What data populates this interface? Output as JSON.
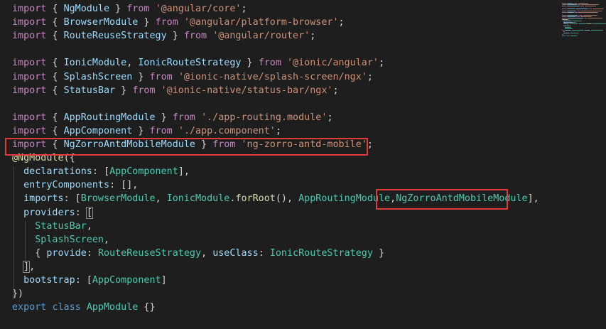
{
  "editor": {
    "language": "typescript",
    "theme_background": "#1e1e1e",
    "lines": [
      [
        [
          "kw",
          "import"
        ],
        [
          "pun",
          " { "
        ],
        [
          "var",
          "NgModule"
        ],
        [
          "pun",
          " } "
        ],
        [
          "kw",
          "from"
        ],
        [
          "pun",
          " "
        ],
        [
          "str",
          "'@angular/core'"
        ],
        [
          "pun",
          ";"
        ]
      ],
      [
        [
          "kw",
          "import"
        ],
        [
          "pun",
          " { "
        ],
        [
          "var",
          "BrowserModule"
        ],
        [
          "pun",
          " } "
        ],
        [
          "kw",
          "from"
        ],
        [
          "pun",
          " "
        ],
        [
          "str",
          "'@angular/platform-browser'"
        ],
        [
          "pun",
          ";"
        ]
      ],
      [
        [
          "kw",
          "import"
        ],
        [
          "pun",
          " { "
        ],
        [
          "var",
          "RouteReuseStrategy"
        ],
        [
          "pun",
          " } "
        ],
        [
          "kw",
          "from"
        ],
        [
          "pun",
          " "
        ],
        [
          "str",
          "'@angular/router'"
        ],
        [
          "pun",
          ";"
        ]
      ],
      [],
      [
        [
          "kw",
          "import"
        ],
        [
          "pun",
          " { "
        ],
        [
          "var",
          "IonicModule"
        ],
        [
          "pun",
          ", "
        ],
        [
          "var",
          "IonicRouteStrategy"
        ],
        [
          "pun",
          " } "
        ],
        [
          "kw",
          "from"
        ],
        [
          "pun",
          " "
        ],
        [
          "str",
          "'@ionic/angular'"
        ],
        [
          "pun",
          ";"
        ]
      ],
      [
        [
          "kw",
          "import"
        ],
        [
          "pun",
          " { "
        ],
        [
          "var",
          "SplashScreen"
        ],
        [
          "pun",
          " } "
        ],
        [
          "kw",
          "from"
        ],
        [
          "pun",
          " "
        ],
        [
          "str",
          "'@ionic-native/splash-screen/ngx'"
        ],
        [
          "pun",
          ";"
        ]
      ],
      [
        [
          "kw",
          "import"
        ],
        [
          "pun",
          " { "
        ],
        [
          "var",
          "StatusBar"
        ],
        [
          "pun",
          " } "
        ],
        [
          "kw",
          "from"
        ],
        [
          "pun",
          " "
        ],
        [
          "str",
          "'@ionic-native/status-bar/ngx'"
        ],
        [
          "pun",
          ";"
        ]
      ],
      [],
      [
        [
          "kw",
          "import"
        ],
        [
          "pun",
          " { "
        ],
        [
          "var",
          "AppRoutingModule"
        ],
        [
          "pun",
          " } "
        ],
        [
          "kw",
          "from"
        ],
        [
          "pun",
          " "
        ],
        [
          "str",
          "'./app-routing.module'"
        ],
        [
          "pun",
          ";"
        ]
      ],
      [
        [
          "kw",
          "import"
        ],
        [
          "pun",
          " { "
        ],
        [
          "var",
          "AppComponent"
        ],
        [
          "pun",
          " } "
        ],
        [
          "kw",
          "from"
        ],
        [
          "pun",
          " "
        ],
        [
          "str",
          "'./app.component'"
        ],
        [
          "pun",
          ";"
        ]
      ],
      [
        [
          "kw",
          "import"
        ],
        [
          "pun",
          " { "
        ],
        [
          "var",
          "NgZorroAntdMobileModule"
        ],
        [
          "pun",
          " } "
        ],
        [
          "kw",
          "from"
        ],
        [
          "pun",
          " "
        ],
        [
          "str",
          "'ng-zorro-antd-mobile'"
        ],
        [
          "pun",
          ";"
        ]
      ],
      [
        [
          "dec",
          "@NgModule"
        ],
        [
          "pun",
          "({"
        ]
      ],
      [
        [
          "pun",
          "  "
        ],
        [
          "var",
          "declarations"
        ],
        [
          "pun",
          ": ["
        ],
        [
          "cls",
          "AppComponent"
        ],
        [
          "pun",
          "],"
        ]
      ],
      [
        [
          "pun",
          "  "
        ],
        [
          "var",
          "entryComponents"
        ],
        [
          "pun",
          ": [],"
        ]
      ],
      [
        [
          "pun",
          "  "
        ],
        [
          "var",
          "imports"
        ],
        [
          "pun",
          ": ["
        ],
        [
          "cls",
          "BrowserModule"
        ],
        [
          "pun",
          ", "
        ],
        [
          "cls",
          "IonicModule"
        ],
        [
          "pun",
          "."
        ],
        [
          "fn",
          "forRoot"
        ],
        [
          "pun",
          "(), "
        ],
        [
          "cls",
          "AppRoutingModule"
        ],
        [
          "pun",
          ","
        ],
        [
          "cls",
          "NgZorroAntdMobileModule"
        ],
        [
          "pun",
          "],"
        ]
      ],
      [
        [
          "pun",
          "  "
        ],
        [
          "var",
          "providers"
        ],
        [
          "pun",
          ": "
        ],
        [
          "bracket",
          "["
        ]
      ],
      [
        [
          "pun",
          "    "
        ],
        [
          "cls",
          "StatusBar"
        ],
        [
          "pun",
          ","
        ]
      ],
      [
        [
          "pun",
          "    "
        ],
        [
          "cls",
          "SplashScreen"
        ],
        [
          "pun",
          ","
        ]
      ],
      [
        [
          "pun",
          "    { "
        ],
        [
          "var",
          "provide"
        ],
        [
          "pun",
          ": "
        ],
        [
          "cls",
          "RouteReuseStrategy"
        ],
        [
          "pun",
          ", "
        ],
        [
          "var",
          "useClass"
        ],
        [
          "pun",
          ": "
        ],
        [
          "cls",
          "IonicRouteStrategy"
        ],
        [
          "pun",
          " }"
        ]
      ],
      [
        [
          "pun",
          "  "
        ],
        [
          "bracket",
          "]"
        ],
        [
          "pun",
          ","
        ]
      ],
      [
        [
          "pun",
          "  "
        ],
        [
          "var",
          "bootstrap"
        ],
        [
          "pun",
          ": ["
        ],
        [
          "cls",
          "AppComponent"
        ],
        [
          "pun",
          "]"
        ]
      ],
      [
        [
          "pun",
          "})"
        ]
      ],
      [
        [
          "kw2",
          "export"
        ],
        [
          "pun",
          " "
        ],
        [
          "kw2",
          "class"
        ],
        [
          "pun",
          " "
        ],
        [
          "cls",
          "AppModule"
        ],
        [
          "pun",
          " {}"
        ]
      ]
    ]
  }
}
